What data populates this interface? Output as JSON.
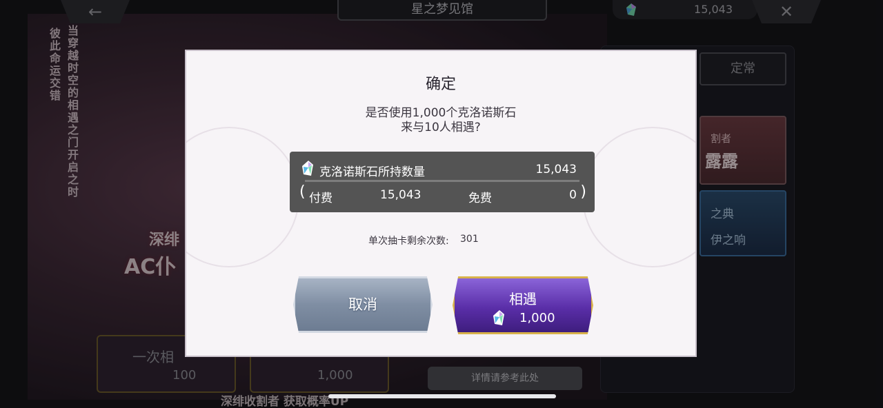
{
  "topbar": {
    "back_symbol": "←",
    "title": "星之梦见馆",
    "currency_value": "15,043",
    "close_symbol": "✕"
  },
  "background": {
    "vertical_text_1": "当穿越时空的相遇之门开启之时",
    "vertical_text_2": "彼此命运交错",
    "banner_line1": "深绯",
    "banner_line2": "AC仆",
    "pull_single_label": "一次相",
    "pull_single_cost": "100",
    "pull_ten_cost": "1,000",
    "details_button": "详情请参考此处",
    "bottom_caption": "深绯收割者 获取概率UP",
    "tab_normal": "定常",
    "side_card_1_line1": "割者",
    "side_card_1_line2": "露露",
    "side_card_2_line1": "之典",
    "side_card_2_line2": "伊之响"
  },
  "dialog": {
    "title": "确定",
    "message_line1": "是否使用1,000个克洛诺斯石",
    "message_line2": "来与10人相遇?",
    "holdings": {
      "label": "克洛诺斯石所持数量",
      "total": "15,043",
      "paren_open": "(",
      "paid_label": "付费",
      "paid_value": "15,043",
      "free_label": "免费",
      "free_value": "0",
      "paren_close": ")"
    },
    "remaining_label": "单次抽卡剩余次数:",
    "remaining_value": "301",
    "cancel_label": "取消",
    "confirm_label": "相遇",
    "confirm_cost": "1,000"
  },
  "icons": {
    "gem": "chronos-stone-icon"
  },
  "colors": {
    "confirm_border": "#d8b24a",
    "confirm_fill": "#5a2ea8",
    "cancel_fill": "#7f8ea3",
    "holdings_panel": "#545454"
  }
}
